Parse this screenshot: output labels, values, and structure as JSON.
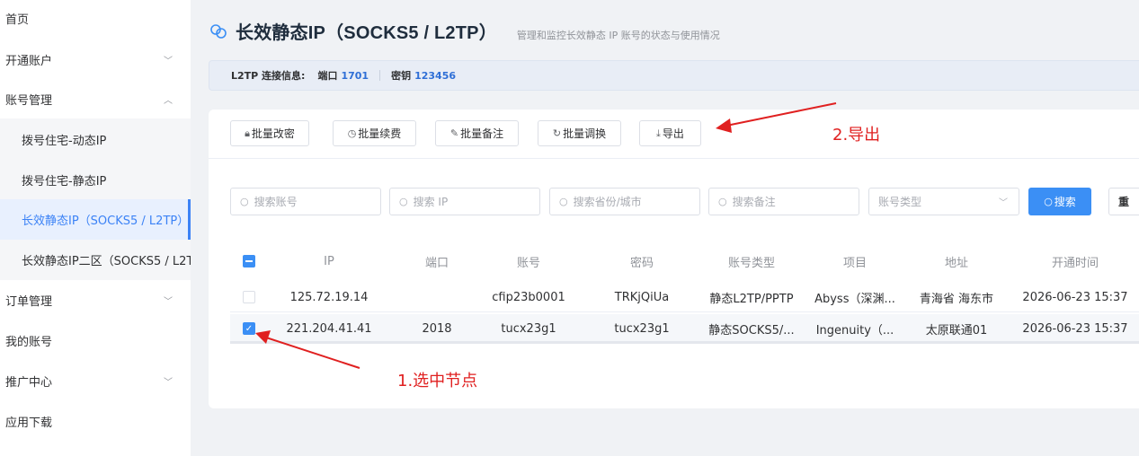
{
  "sidebar": {
    "items": [
      {
        "label": "首页"
      },
      {
        "label": "开通账户"
      },
      {
        "label": "账号管理"
      },
      {
        "label": "订单管理"
      },
      {
        "label": "我的账号"
      },
      {
        "label": "推广中心"
      },
      {
        "label": "应用下载"
      }
    ],
    "submenu": [
      {
        "label": "拨号住宅-动态IP"
      },
      {
        "label": "拨号住宅-静态IP"
      },
      {
        "label": "长效静态IP（SOCKS5 / L2TP）",
        "active": true
      },
      {
        "label": "长效静态IP二区（SOCKS5 / L2T"
      }
    ]
  },
  "header": {
    "title": "长效静态IP（SOCKS5 / L2TP）",
    "subtitle": "管理和监控长效静态 IP 账号的状态与使用情况",
    "icon": "link-icon"
  },
  "info_bar": {
    "label": "L2TP 连接信息:",
    "port_label": "端口",
    "port_value": "1701",
    "key_label": "密钥",
    "key_value": "123456"
  },
  "toolbar": {
    "batch_password": "批量改密",
    "batch_renew": "批量续费",
    "batch_remark": "批量备注",
    "batch_switch": "批量调换",
    "export": "导出"
  },
  "filters": {
    "account_placeholder": "搜索账号",
    "ip_placeholder": "搜索 IP",
    "region_placeholder": "搜索省份/城市",
    "remark_placeholder": "搜索备注",
    "type_placeholder": "账号类型",
    "search_label": "搜索",
    "reset_label": "重"
  },
  "table": {
    "columns": [
      "IP",
      "端口",
      "账号",
      "密码",
      "账号类型",
      "项目",
      "地址",
      "开通时间"
    ],
    "rows": [
      {
        "ip": "125.72.19.14",
        "port": "",
        "account": "cfip23b0001",
        "password": "TRKjQiUa",
        "type": "静态L2TP/PPTP",
        "project": "Abyss（深渊...",
        "address": "青海省 海东市",
        "opened": "2026-06-23 15:37",
        "checked": false
      },
      {
        "ip": "221.204.41.41",
        "port": "2018",
        "account": "tucx23g1",
        "password": "tucx23g1",
        "type": "静态SOCKS5/...",
        "project": "Ingenuity（...",
        "address": "太原联通01",
        "opened": "2026-06-23 15:37",
        "checked": true
      }
    ]
  },
  "annotations": {
    "step1": "1.选中节点",
    "step2": "2.导出",
    "color": "#e02020"
  },
  "colors": {
    "accent": "#3b8ff5",
    "active_menu_bg": "#e8f0fe",
    "active_menu_text": "#3b82f6"
  }
}
